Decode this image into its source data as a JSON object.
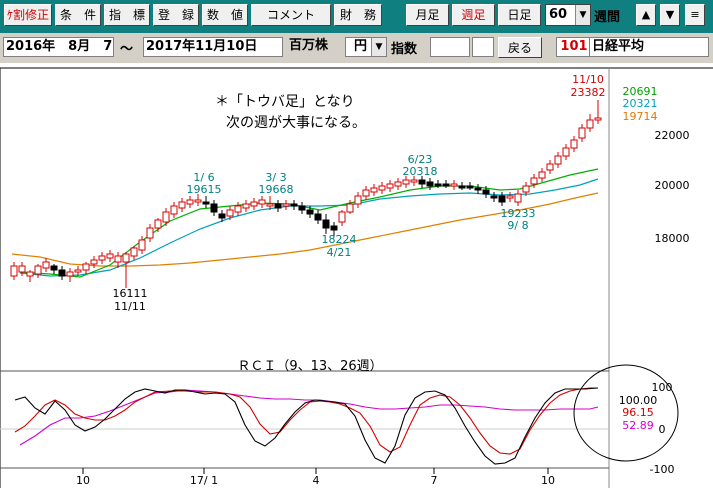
{
  "toolbar": {
    "buttons": [
      "ｹ割修正",
      "条　件",
      "指　標",
      "登　録",
      "数　値",
      "コメント",
      "財　務"
    ],
    "monthly": "月足",
    "weekly": "週足",
    "daily": "日足",
    "period_value": "60",
    "period_unit": "週間",
    "up_icon": "▲",
    "down_icon": "▼",
    "menu_icon": "≡"
  },
  "bar2": {
    "start_date": "2016年　8月　7日",
    "tilde": "～",
    "end_date": "2017年11月10日",
    "unit": "百万株",
    "currency": "円",
    "index_label": "指数",
    "back_button": "戻る",
    "code": "101",
    "name": "日経平均"
  },
  "annotation": {
    "line1": "＊「トウバ足」となり",
    "line2": "次の週が大事になる。"
  },
  "price_chart": {
    "yticks": [
      "22000",
      "20000",
      "18000"
    ],
    "legend": [
      {
        "text": "20691",
        "color": "#00a000"
      },
      {
        "text": "20321",
        "color": "#00a0c0"
      },
      {
        "text": "19714",
        "color": "#e07800"
      }
    ],
    "labels": [
      {
        "date": "11/10",
        "value": "23382"
      },
      {
        "date": "1/ 6",
        "value": "19615"
      },
      {
        "date": "3/ 3",
        "value": "19668"
      },
      {
        "date": "6/23",
        "value": "20318"
      },
      {
        "date": "4/21",
        "value": "18224"
      },
      {
        "date": "9/ 8",
        "value": "19233"
      },
      {
        "date": "11/11",
        "value": "16111"
      }
    ]
  },
  "rci": {
    "title": "ＲＣＩ（9、13、26週）",
    "yticks": [
      "100",
      "0",
      "-100"
    ],
    "values": [
      {
        "text": "100.00",
        "color": "#000000"
      },
      {
        "text": "96.15",
        "color": "#d40000"
      },
      {
        "text": "52.89",
        "color": "#d000d0"
      }
    ]
  },
  "xaxis": [
    "10",
    "17/ 1",
    "4",
    "7",
    "10"
  ],
  "colors": {
    "toolbar_bg": "#0f7f7f",
    "candle_up": "#d40000",
    "candle_down": "#000000",
    "ma_short": "#00b000",
    "ma_mid": "#00a0c0",
    "ma_long": "#e08000",
    "rci9": "#000000",
    "rci13": "#d40000",
    "rci26": "#d000d0"
  }
}
